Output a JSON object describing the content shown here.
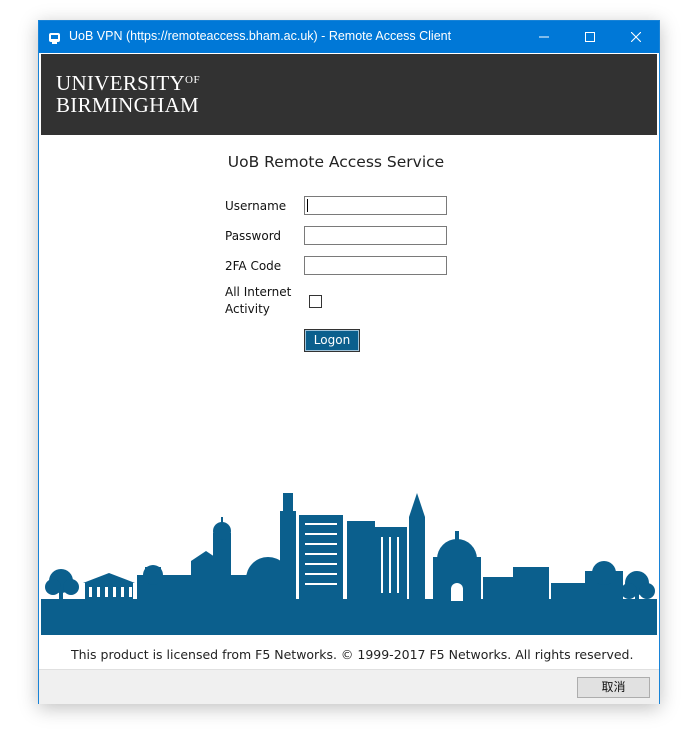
{
  "window": {
    "title": "UoB VPN (https://remoteaccess.bham.ac.uk) - Remote Access Client"
  },
  "banner": {
    "line1": "UNIVERSITY",
    "line1_suffix": "OF",
    "line2": "BIRMINGHAM"
  },
  "form": {
    "title": "UoB Remote Access Service",
    "username_label": "Username",
    "username_value": "",
    "password_label": "Password",
    "password_value": "",
    "code_label": "2FA Code",
    "code_value": "",
    "all_internet_label_1": "All Internet",
    "all_internet_label_2": "Activity",
    "all_internet_checked": false,
    "logon_label": "Logon"
  },
  "footer": {
    "text": "This product is licensed from F5 Networks. © 1999-2017 F5 Networks. All rights reserved."
  },
  "statusbar": {
    "cancel_label": "取消"
  },
  "colors": {
    "titlebar": "#0078d7",
    "banner": "#323232",
    "skyline": "#0b5f8d"
  }
}
